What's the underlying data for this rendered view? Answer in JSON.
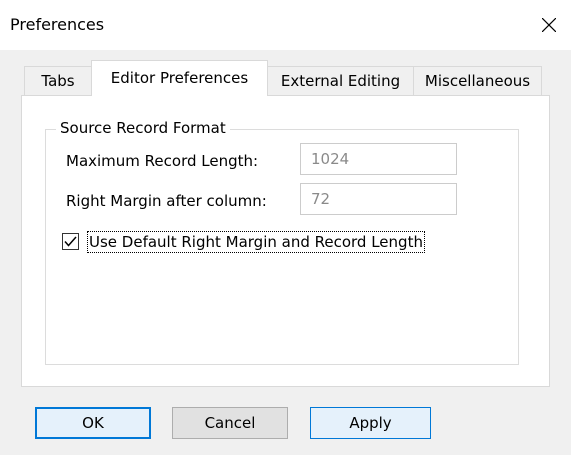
{
  "window": {
    "title": "Preferences",
    "close_icon": "close-icon"
  },
  "tabs": [
    {
      "label": "Tabs",
      "active": false
    },
    {
      "label": "Editor Preferences",
      "active": true
    },
    {
      "label": "External Editing",
      "active": false
    },
    {
      "label": "Miscellaneous",
      "active": false
    }
  ],
  "editor": {
    "group_title": "Source Record Format",
    "max_record_length": {
      "label": "Maximum Record Length:",
      "value": "1024"
    },
    "right_margin": {
      "label": "Right Margin after column:",
      "value": "72"
    },
    "use_default": {
      "label": "Use Default Right Margin and Record Length",
      "checked": true
    }
  },
  "buttons": {
    "ok": "OK",
    "cancel": "Cancel",
    "apply": "Apply"
  },
  "colors": {
    "accent": "#0078d7",
    "window_bg": "#f0f0f0",
    "panel_bg": "#ffffff",
    "disabled_text": "#8a8a8a"
  }
}
